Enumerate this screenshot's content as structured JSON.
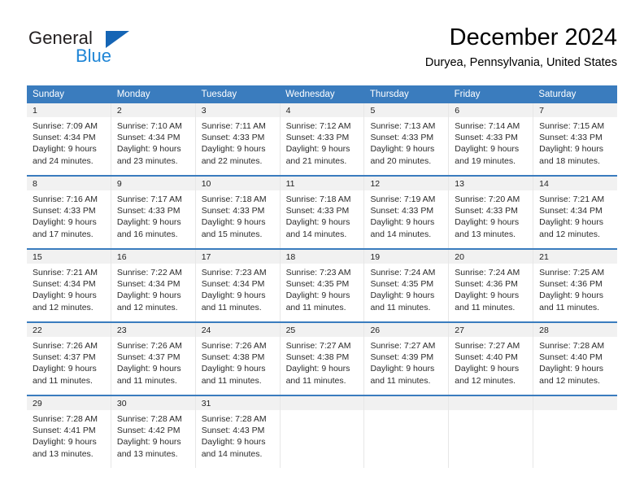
{
  "brand": {
    "name_top": "General",
    "name_bottom": "Blue",
    "color_dark": "#231f20",
    "color_blue": "#1e85d6",
    "triangle_color": "#1565b5"
  },
  "header": {
    "title": "December 2024",
    "subtitle": "Duryea, Pennsylvania, United States"
  },
  "theme": {
    "header_row_bg": "#3a7cbe",
    "day_number_bg": "#f1f1f1",
    "cell_border": "#e7e7e7",
    "text": "#2b2b2b"
  },
  "weekdays": [
    "Sunday",
    "Monday",
    "Tuesday",
    "Wednesday",
    "Thursday",
    "Friday",
    "Saturday"
  ],
  "weeks": [
    [
      {
        "day": "1",
        "sunrise": "Sunrise: 7:09 AM",
        "sunset": "Sunset: 4:34 PM",
        "daylight1": "Daylight: 9 hours",
        "daylight2": "and 24 minutes."
      },
      {
        "day": "2",
        "sunrise": "Sunrise: 7:10 AM",
        "sunset": "Sunset: 4:34 PM",
        "daylight1": "Daylight: 9 hours",
        "daylight2": "and 23 minutes."
      },
      {
        "day": "3",
        "sunrise": "Sunrise: 7:11 AM",
        "sunset": "Sunset: 4:33 PM",
        "daylight1": "Daylight: 9 hours",
        "daylight2": "and 22 minutes."
      },
      {
        "day": "4",
        "sunrise": "Sunrise: 7:12 AM",
        "sunset": "Sunset: 4:33 PM",
        "daylight1": "Daylight: 9 hours",
        "daylight2": "and 21 minutes."
      },
      {
        "day": "5",
        "sunrise": "Sunrise: 7:13 AM",
        "sunset": "Sunset: 4:33 PM",
        "daylight1": "Daylight: 9 hours",
        "daylight2": "and 20 minutes."
      },
      {
        "day": "6",
        "sunrise": "Sunrise: 7:14 AM",
        "sunset": "Sunset: 4:33 PM",
        "daylight1": "Daylight: 9 hours",
        "daylight2": "and 19 minutes."
      },
      {
        "day": "7",
        "sunrise": "Sunrise: 7:15 AM",
        "sunset": "Sunset: 4:33 PM",
        "daylight1": "Daylight: 9 hours",
        "daylight2": "and 18 minutes."
      }
    ],
    [
      {
        "day": "8",
        "sunrise": "Sunrise: 7:16 AM",
        "sunset": "Sunset: 4:33 PM",
        "daylight1": "Daylight: 9 hours",
        "daylight2": "and 17 minutes."
      },
      {
        "day": "9",
        "sunrise": "Sunrise: 7:17 AM",
        "sunset": "Sunset: 4:33 PM",
        "daylight1": "Daylight: 9 hours",
        "daylight2": "and 16 minutes."
      },
      {
        "day": "10",
        "sunrise": "Sunrise: 7:18 AM",
        "sunset": "Sunset: 4:33 PM",
        "daylight1": "Daylight: 9 hours",
        "daylight2": "and 15 minutes."
      },
      {
        "day": "11",
        "sunrise": "Sunrise: 7:18 AM",
        "sunset": "Sunset: 4:33 PM",
        "daylight1": "Daylight: 9 hours",
        "daylight2": "and 14 minutes."
      },
      {
        "day": "12",
        "sunrise": "Sunrise: 7:19 AM",
        "sunset": "Sunset: 4:33 PM",
        "daylight1": "Daylight: 9 hours",
        "daylight2": "and 14 minutes."
      },
      {
        "day": "13",
        "sunrise": "Sunrise: 7:20 AM",
        "sunset": "Sunset: 4:33 PM",
        "daylight1": "Daylight: 9 hours",
        "daylight2": "and 13 minutes."
      },
      {
        "day": "14",
        "sunrise": "Sunrise: 7:21 AM",
        "sunset": "Sunset: 4:34 PM",
        "daylight1": "Daylight: 9 hours",
        "daylight2": "and 12 minutes."
      }
    ],
    [
      {
        "day": "15",
        "sunrise": "Sunrise: 7:21 AM",
        "sunset": "Sunset: 4:34 PM",
        "daylight1": "Daylight: 9 hours",
        "daylight2": "and 12 minutes."
      },
      {
        "day": "16",
        "sunrise": "Sunrise: 7:22 AM",
        "sunset": "Sunset: 4:34 PM",
        "daylight1": "Daylight: 9 hours",
        "daylight2": "and 12 minutes."
      },
      {
        "day": "17",
        "sunrise": "Sunrise: 7:23 AM",
        "sunset": "Sunset: 4:34 PM",
        "daylight1": "Daylight: 9 hours",
        "daylight2": "and 11 minutes."
      },
      {
        "day": "18",
        "sunrise": "Sunrise: 7:23 AM",
        "sunset": "Sunset: 4:35 PM",
        "daylight1": "Daylight: 9 hours",
        "daylight2": "and 11 minutes."
      },
      {
        "day": "19",
        "sunrise": "Sunrise: 7:24 AM",
        "sunset": "Sunset: 4:35 PM",
        "daylight1": "Daylight: 9 hours",
        "daylight2": "and 11 minutes."
      },
      {
        "day": "20",
        "sunrise": "Sunrise: 7:24 AM",
        "sunset": "Sunset: 4:36 PM",
        "daylight1": "Daylight: 9 hours",
        "daylight2": "and 11 minutes."
      },
      {
        "day": "21",
        "sunrise": "Sunrise: 7:25 AM",
        "sunset": "Sunset: 4:36 PM",
        "daylight1": "Daylight: 9 hours",
        "daylight2": "and 11 minutes."
      }
    ],
    [
      {
        "day": "22",
        "sunrise": "Sunrise: 7:26 AM",
        "sunset": "Sunset: 4:37 PM",
        "daylight1": "Daylight: 9 hours",
        "daylight2": "and 11 minutes."
      },
      {
        "day": "23",
        "sunrise": "Sunrise: 7:26 AM",
        "sunset": "Sunset: 4:37 PM",
        "daylight1": "Daylight: 9 hours",
        "daylight2": "and 11 minutes."
      },
      {
        "day": "24",
        "sunrise": "Sunrise: 7:26 AM",
        "sunset": "Sunset: 4:38 PM",
        "daylight1": "Daylight: 9 hours",
        "daylight2": "and 11 minutes."
      },
      {
        "day": "25",
        "sunrise": "Sunrise: 7:27 AM",
        "sunset": "Sunset: 4:38 PM",
        "daylight1": "Daylight: 9 hours",
        "daylight2": "and 11 minutes."
      },
      {
        "day": "26",
        "sunrise": "Sunrise: 7:27 AM",
        "sunset": "Sunset: 4:39 PM",
        "daylight1": "Daylight: 9 hours",
        "daylight2": "and 11 minutes."
      },
      {
        "day": "27",
        "sunrise": "Sunrise: 7:27 AM",
        "sunset": "Sunset: 4:40 PM",
        "daylight1": "Daylight: 9 hours",
        "daylight2": "and 12 minutes."
      },
      {
        "day": "28",
        "sunrise": "Sunrise: 7:28 AM",
        "sunset": "Sunset: 4:40 PM",
        "daylight1": "Daylight: 9 hours",
        "daylight2": "and 12 minutes."
      }
    ],
    [
      {
        "day": "29",
        "sunrise": "Sunrise: 7:28 AM",
        "sunset": "Sunset: 4:41 PM",
        "daylight1": "Daylight: 9 hours",
        "daylight2": "and 13 minutes."
      },
      {
        "day": "30",
        "sunrise": "Sunrise: 7:28 AM",
        "sunset": "Sunset: 4:42 PM",
        "daylight1": "Daylight: 9 hours",
        "daylight2": "and 13 minutes."
      },
      {
        "day": "31",
        "sunrise": "Sunrise: 7:28 AM",
        "sunset": "Sunset: 4:43 PM",
        "daylight1": "Daylight: 9 hours",
        "daylight2": "and 14 minutes."
      },
      {
        "day": "",
        "sunrise": "",
        "sunset": "",
        "daylight1": "",
        "daylight2": ""
      },
      {
        "day": "",
        "sunrise": "",
        "sunset": "",
        "daylight1": "",
        "daylight2": ""
      },
      {
        "day": "",
        "sunrise": "",
        "sunset": "",
        "daylight1": "",
        "daylight2": ""
      },
      {
        "day": "",
        "sunrise": "",
        "sunset": "",
        "daylight1": "",
        "daylight2": ""
      }
    ]
  ]
}
